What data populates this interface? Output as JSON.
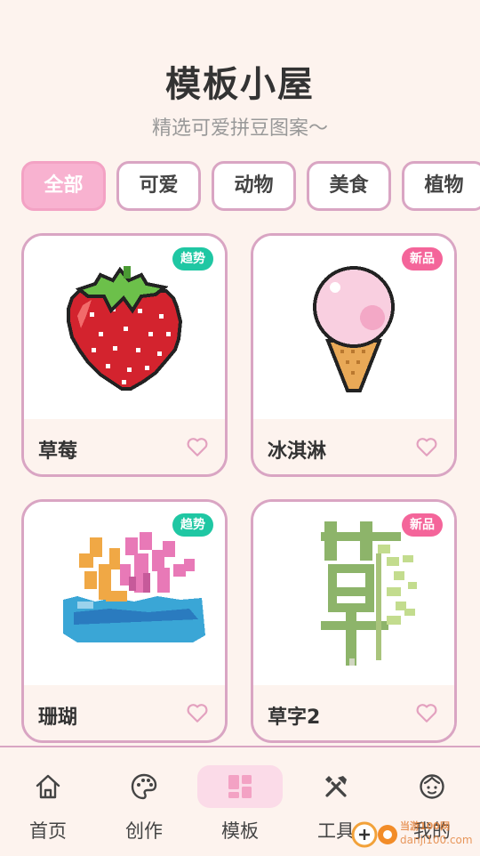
{
  "header": {
    "title": "模板小屋",
    "subtitle": "精选可爱拼豆图案～"
  },
  "tabs": [
    {
      "label": "全部",
      "active": true
    },
    {
      "label": "可爱",
      "active": false
    },
    {
      "label": "动物",
      "active": false
    },
    {
      "label": "美食",
      "active": false
    },
    {
      "label": "植物",
      "active": false
    }
  ],
  "cards": [
    {
      "name": "草莓",
      "badge": "趋势",
      "image": "strawberry-pixel-art"
    },
    {
      "name": "冰淇淋",
      "badge": "新品",
      "image": "ice-cream-pixel-art"
    },
    {
      "name": "珊瑚",
      "badge": "趋势",
      "image": "coral-pixel-art"
    },
    {
      "name": "草字2",
      "badge": "新品",
      "image": "grass-character-pixel-art"
    }
  ],
  "nav": {
    "items": [
      {
        "label": "首页",
        "icon": "home-icon"
      },
      {
        "label": "创作",
        "icon": "palette-icon"
      },
      {
        "label": "模板",
        "icon": "template-icon",
        "active": true
      },
      {
        "label": "工具",
        "icon": "tools-icon"
      },
      {
        "label": "我的",
        "icon": "profile-icon"
      }
    ]
  },
  "colors": {
    "accent": "#f8b2d0",
    "border": "#d9a5c3",
    "trend": "#1fc7a3",
    "new": "#f4659a",
    "background": "#fdf3ee"
  },
  "watermark": {
    "text": "danji100.com",
    "brand": "当游100网"
  }
}
